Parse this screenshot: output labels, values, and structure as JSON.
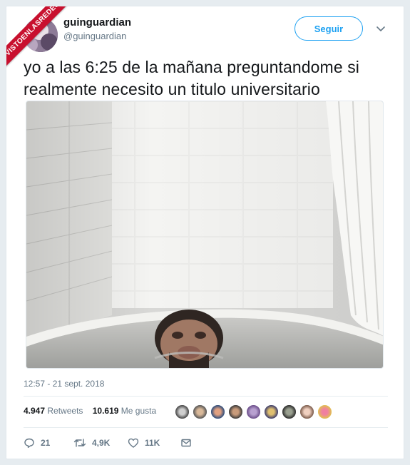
{
  "watermark": "VISTOENLASREDES",
  "user": {
    "name": "guinguardian",
    "handle": "@guinguardian"
  },
  "follow_label": "Seguir",
  "tweet": {
    "text": "yo a las 6:25 de la mañana preguntandome si realmente necesito un titulo universitario",
    "timestamp": "12:57 - 21 sept. 2018"
  },
  "stats": {
    "retweets_count": "4.947",
    "retweets_label": "Retweets",
    "likes_count": "10.619",
    "likes_label": "Me gusta"
  },
  "actions": {
    "replies": "21",
    "retweets": "4,9K",
    "likes": "11K"
  },
  "colors": {
    "accent": "#1da1f2",
    "text": "#14171a",
    "muted": "#657786",
    "ribbon": "#c8102e"
  },
  "icons": [
    "reply-icon",
    "retweet-icon",
    "like-icon",
    "message-icon",
    "chevron-down-icon"
  ]
}
